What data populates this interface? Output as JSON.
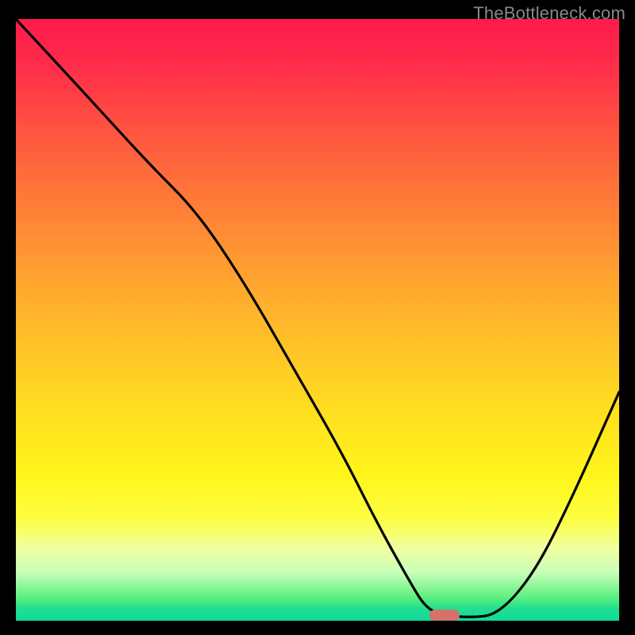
{
  "watermark": "TheBottleneck.com",
  "chart_data": {
    "type": "line",
    "title": "",
    "xlabel": "",
    "ylabel": "",
    "x_range": [
      0,
      100
    ],
    "y_range": [
      0,
      100
    ],
    "series": [
      {
        "name": "curve",
        "x": [
          0,
          12,
          22,
          30,
          38,
          46,
          54,
          60,
          65,
          68,
          71,
          75,
          80,
          86,
          92,
          100
        ],
        "y": [
          100,
          87,
          76,
          68,
          56,
          42,
          28,
          16,
          7,
          2,
          1,
          0.5,
          1,
          8,
          20,
          38
        ]
      }
    ],
    "marker": {
      "x": 71,
      "y": 0.5
    },
    "background_gradient": {
      "top": "#ff1a4d",
      "bottom": "#10d89c",
      "meaning": "value scale from high (red) to optimal (green)"
    }
  },
  "colors": {
    "frame": "#000000",
    "curve": "#000000",
    "marker": "#d8706a",
    "watermark": "#888888"
  }
}
